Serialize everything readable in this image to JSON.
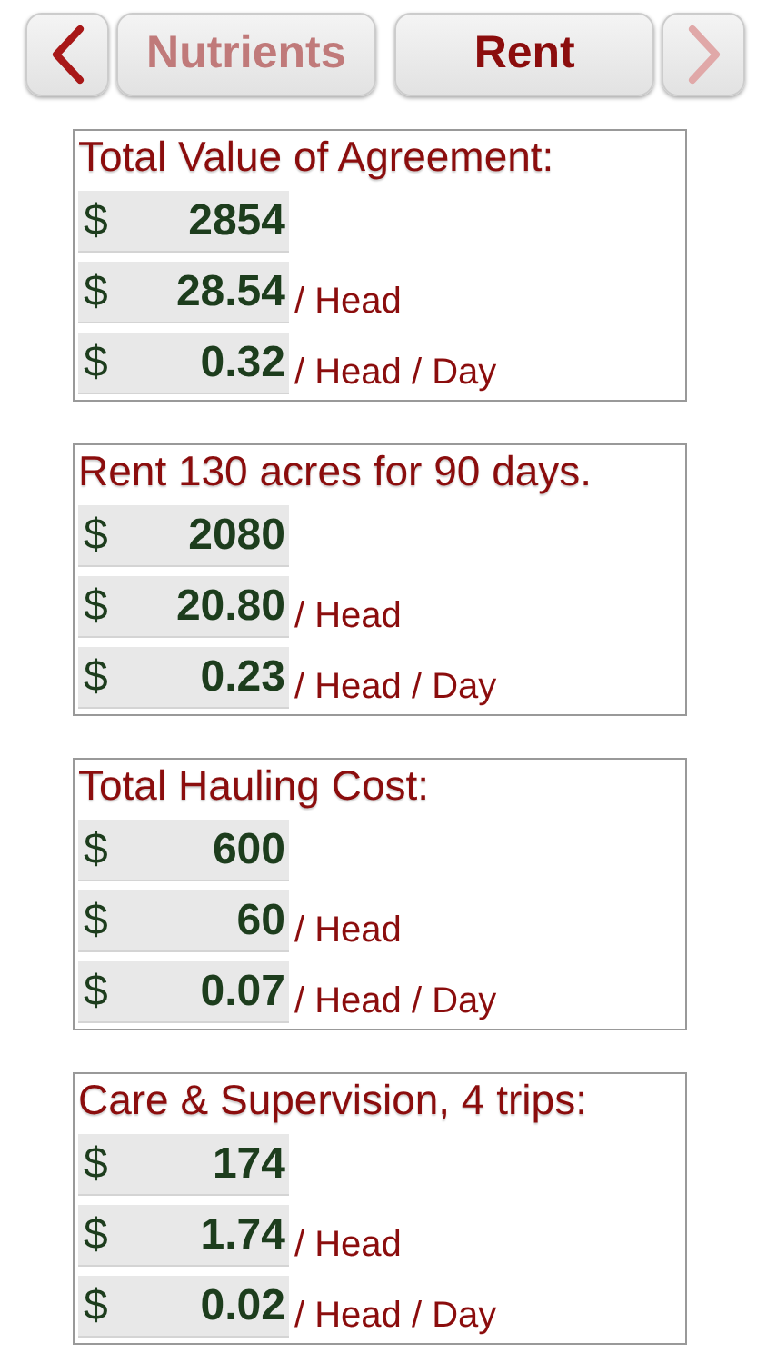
{
  "nav": {
    "back": {
      "disabled": false
    },
    "forward": {
      "disabled": true
    },
    "tabs": [
      {
        "label": "Nutrients",
        "selected": false
      },
      {
        "label": "Rent",
        "selected": true
      }
    ]
  },
  "cards": [
    {
      "title": "Total Value of Agreement:",
      "rows": [
        {
          "currency": "$",
          "value": "2854"
        },
        {
          "currency": "$",
          "value": "28.54",
          "unit": "/ Head"
        },
        {
          "currency": "$",
          "value": "0.32",
          "unit": "/ Head / Day"
        }
      ]
    },
    {
      "title": "Rent 130 acres for 90 days.",
      "rows": [
        {
          "currency": "$",
          "value": "2080"
        },
        {
          "currency": "$",
          "value": "20.80",
          "unit": "/ Head"
        },
        {
          "currency": "$",
          "value": "0.23",
          "unit": "/ Head / Day"
        }
      ]
    },
    {
      "title": "Total Hauling Cost:",
      "rows": [
        {
          "currency": "$",
          "value": "600"
        },
        {
          "currency": "$",
          "value": "60",
          "unit": "/ Head"
        },
        {
          "currency": "$",
          "value": "0.07",
          "unit": "/ Head / Day"
        }
      ]
    },
    {
      "title": "Care & Supervision, 4 trips:",
      "rows": [
        {
          "currency": "$",
          "value": "174"
        },
        {
          "currency": "$",
          "value": "1.74",
          "unit": "/ Head"
        },
        {
          "currency": "$",
          "value": "0.02",
          "unit": "/ Head / Day"
        }
      ]
    }
  ]
}
